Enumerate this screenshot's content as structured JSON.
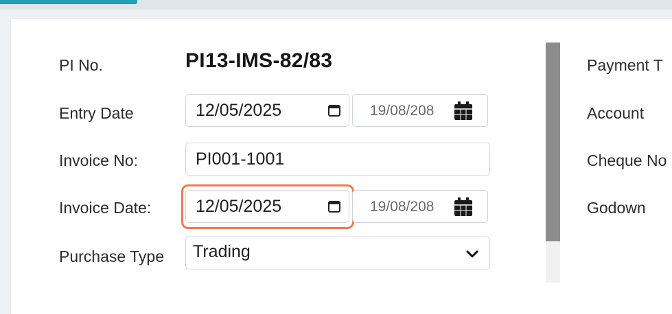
{
  "form": {
    "pi_no_label": "PI No.",
    "pi_no_value": "PI13-IMS-82/83",
    "entry_date_label": "Entry Date",
    "entry_date_value": "12/05/2025",
    "entry_date_nepali": "19/08/208",
    "invoice_no_label": "Invoice No:",
    "invoice_no_value": "PI001-1001",
    "invoice_date_label": "Invoice Date:",
    "invoice_date_value": "12/05/2025",
    "invoice_date_nepali": "19/08/208",
    "purchase_type_label": "Purchase Type",
    "purchase_type_value": "Trading"
  },
  "right_column": {
    "payment_label": "Payment T",
    "account_label": "Account",
    "cheque_label": "Cheque No",
    "godown_label": "Godown"
  },
  "colors": {
    "accent": "#1f9fb8",
    "highlight": "#ef7a4d"
  }
}
